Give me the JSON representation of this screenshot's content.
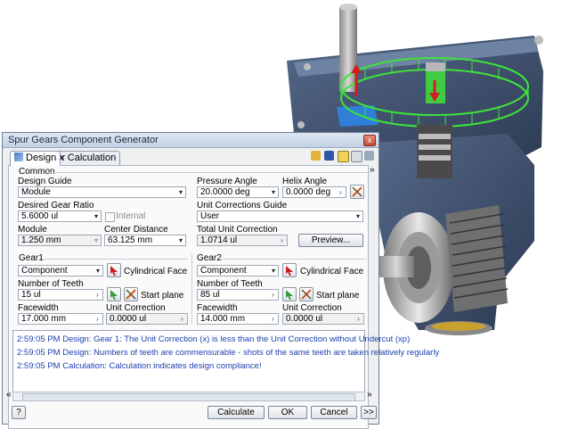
{
  "window": {
    "title": "Spur Gears Component Generator",
    "close_glyph": "x"
  },
  "tabs": [
    {
      "label": "Design"
    },
    {
      "label": "Calculation"
    }
  ],
  "common": {
    "section_label": "Common",
    "design_guide": {
      "label": "Design Guide",
      "value": "Module"
    },
    "gear_ratio": {
      "label": "Desired Gear Ratio",
      "value": "5.6000 ul"
    },
    "internal": {
      "label": "Internal",
      "checked": false
    },
    "module": {
      "label": "Module",
      "value": "1.250 mm"
    },
    "center_distance": {
      "label": "Center Distance",
      "value": "63.125 mm"
    },
    "pressure_angle": {
      "label": "Pressure Angle",
      "value": "20.0000 deg"
    },
    "helix_angle": {
      "label": "Helix Angle",
      "value": "0.0000 deg"
    },
    "unit_corrections_guide": {
      "label": "Unit Corrections Guide",
      "value": "User"
    },
    "total_unit_correction": {
      "label": "Total Unit Correction",
      "value": "1.0714 ul"
    },
    "preview_label": "Preview..."
  },
  "gear1": {
    "section_label": "Gear1",
    "type": "Component",
    "face_label": "Cylindrical Face",
    "start_label": "Start plane",
    "teeth": {
      "label": "Number of Teeth",
      "value": "15 ul"
    },
    "facewidth": {
      "label": "Facewidth",
      "value": "17.000 mm"
    },
    "unit_correction": {
      "label": "Unit Correction",
      "value": "0.0000 ul"
    }
  },
  "gear2": {
    "section_label": "Gear2",
    "type": "Component",
    "face_label": "Cylindrical Face",
    "start_label": "Start plane",
    "teeth": {
      "label": "Number of Teeth",
      "value": "85 ul"
    },
    "facewidth": {
      "label": "Facewidth",
      "value": "14.000 mm"
    },
    "unit_correction": {
      "label": "Unit Correction",
      "value": "0.0000 ul"
    }
  },
  "messages": [
    "2:59:05 PM Design: Gear 1: The Unit Correction (x) is less than the Unit Correction without Undercut (xp)",
    "2:59:05 PM Design: Numbers of teeth are commensurable - shots of the same teeth are taken relatively regularly",
    "2:59:05 PM Calculation: Calculation indicates design compliance!"
  ],
  "footer": {
    "help": "?",
    "calculate": "Calculate",
    "ok": "OK",
    "cancel": "Cancel",
    "more": ">>"
  },
  "glyphs": {
    "dropdown": "▾",
    "right": "›",
    "expand": "»",
    "collapse": "«",
    "up": "⌃"
  },
  "icon_names": [
    "folder-open-icon",
    "save-icon",
    "help-icon",
    "fx-icon",
    "settings-icon"
  ],
  "colors": {
    "accent_green": "#3ee23a",
    "housing_blue": "#3a4a63",
    "message_blue": "#1d3fb0"
  }
}
